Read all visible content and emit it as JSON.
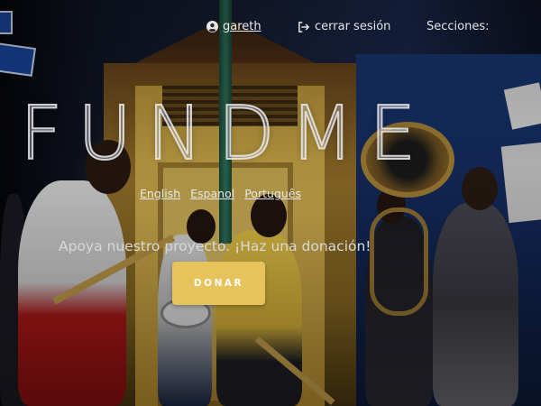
{
  "header": {
    "user_name": "gareth",
    "logout_label": "cerrar sesión",
    "sections_label": "Secciones:"
  },
  "hero": {
    "brand": "FUNDME",
    "languages": [
      "English",
      "Espanol",
      "Português"
    ],
    "tagline": "Apoya nuestro proyecto. ¡Haz una donación!",
    "donate_label": "DONAR"
  },
  "colors": {
    "donate_button": "#e6c45b",
    "text": "#e4e4e4"
  },
  "icons": {
    "user": "user-circle-icon",
    "logout": "sign-out-icon"
  }
}
